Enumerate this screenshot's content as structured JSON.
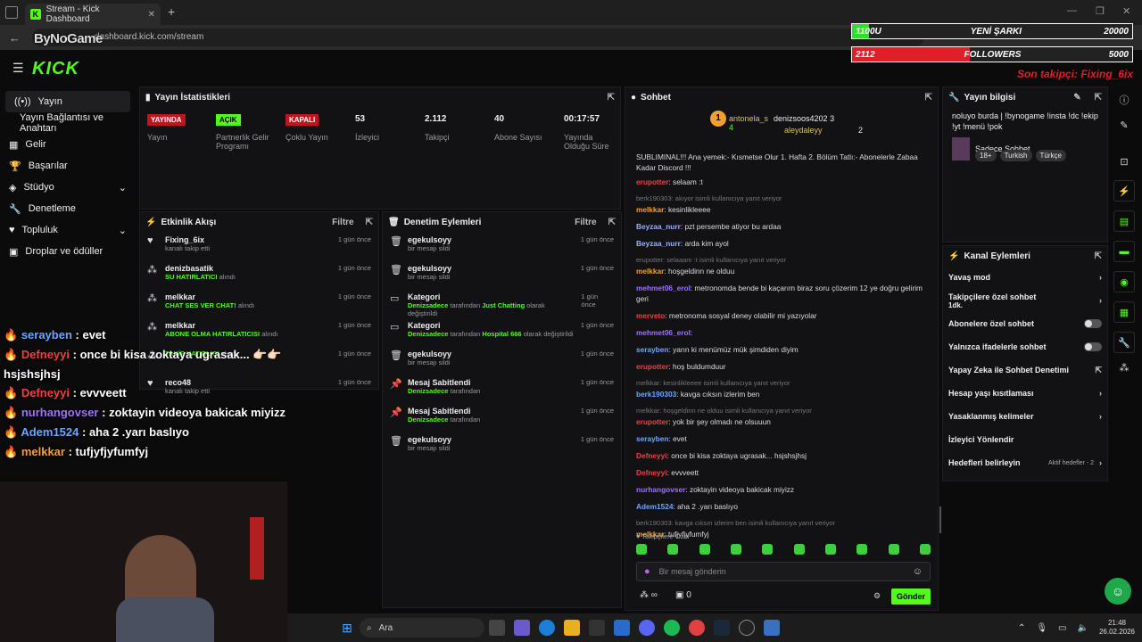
{
  "browser": {
    "tab_title": "Stream - Kick Dashboard",
    "url": "dashboard.kick.com/stream",
    "watermark": "ByNoGame"
  },
  "logo": "KICK",
  "overlay": {
    "songs_left": "1100U",
    "songs_label": "YENİ ŞARKI",
    "songs_right": "20000",
    "followers_left": "2112",
    "followers_label": "FOLLOWERS",
    "followers_right": "5000",
    "last_follower": "Son takipçi: Fixing_6ix",
    "song_fill": 0.06,
    "follower_fill": 0.42
  },
  "sidebar": {
    "items": [
      {
        "label": "Yayın"
      },
      {
        "label": "Yayın Bağlantısı ve Anahtarı"
      },
      {
        "label": "Gelir"
      },
      {
        "label": "Başarılar"
      },
      {
        "label": "Stüdyo"
      },
      {
        "label": "Denetleme"
      },
      {
        "label": "Topluluk"
      },
      {
        "label": "Droplar ve ödüller"
      }
    ]
  },
  "stats": {
    "title": "Yayın İstatistikleri",
    "items": [
      {
        "value": "YAYINDA",
        "label": "Yayın"
      },
      {
        "value": "AÇIK",
        "label": "Partnerlik Gelir Programı"
      },
      {
        "value": "KAPALI",
        "label": "Çoklu Yayın"
      },
      {
        "value": "53",
        "label": "İzleyici"
      },
      {
        "value": "2.112",
        "label": "Takipçi"
      },
      {
        "value": "40",
        "label": "Abone Sayısı"
      },
      {
        "value": "00:17:57",
        "label": "Yayında Olduğu Süre"
      }
    ]
  },
  "activity": {
    "title": "Etkinlik Akışı",
    "filter": "Filtre",
    "items": [
      {
        "name": "Fixing_6ix",
        "sub": "kanalı takip etti",
        "sub_green": "",
        "time": "1 gün önce"
      },
      {
        "name": "denizbasatik",
        "sub": "alındı",
        "sub_green": "SU HATIRLATICI",
        "time": "1 gün önce"
      },
      {
        "name": "melkkar",
        "sub": "alındı",
        "sub_green": "CHAT SES VER CHAT!",
        "time": "1 gün önce"
      },
      {
        "name": "melkkar",
        "sub": "alındı",
        "sub_green": "ABONE OLMA HATIRLATICISI",
        "time": "1 gün önce"
      },
      {
        "name": "",
        "sub": "alındı",
        "sub_green": "TAKİP HATIRLICI",
        "time": "1 gün önce"
      },
      {
        "name": "reco48",
        "sub": "kanalı takip etti",
        "sub_green": "",
        "time": "1 gün önce"
      }
    ]
  },
  "moderation": {
    "title": "Denetim Eylemleri",
    "filter": "Filtre",
    "items": [
      {
        "name": "egekulsoyy",
        "sub": "bir mesajı sildi",
        "time": "1 gün önce",
        "icon": "trash"
      },
      {
        "name": "egekulsoyy",
        "sub": "bir mesajı sildi",
        "time": "1 gün önce",
        "icon": "trash"
      },
      {
        "name": "Kategori",
        "by": "Denizsadece",
        "mid": "tarafından",
        "cat": "Just Chatting",
        "end": "olarak değiştirildi",
        "time": "1 gün önce",
        "icon": "cat"
      },
      {
        "name": "Kategori",
        "by": "Denizsadece",
        "mid": "tarafından",
        "cat": "Hospital 666",
        "end": "olarak değiştirildi",
        "time": "1 gün önce",
        "icon": "cat"
      },
      {
        "name": "egekulsoyy",
        "sub": "bir mesajı sildi",
        "time": "1 gün önce",
        "icon": "trash"
      },
      {
        "name": "Mesaj Sabitlendi",
        "by": "Denizsadece",
        "mid": "tarafından",
        "time": "1 gün önce",
        "icon": "pin"
      },
      {
        "name": "Mesaj Sabitlendi",
        "by": "Denizsadece",
        "mid": "tarafından",
        "time": "1 gün önce",
        "icon": "pin"
      },
      {
        "name": "egekulsoyy",
        "sub": "bir mesajı sildi",
        "time": "1 gün önce",
        "icon": "trash"
      }
    ]
  },
  "chat": {
    "title": "Sohbet",
    "top": [
      {
        "name": "antonela_s",
        "count": "4"
      },
      {
        "name": "denizsoos4202",
        "count": "3"
      },
      {
        "name": "aleydaleyy",
        "count": "2"
      }
    ],
    "pinned": "SUBLIMINAL!!! Ana yemek:- Kısmetse Olur 1. Hafta 2. Bölüm Tatlı:- Abonelerle Zabaa Kadar Discord !!!",
    "messages": [
      {
        "user": "erupotter",
        "color": "#f04040",
        "text": "selaam :t",
        "rep": ""
      },
      {
        "user": "melkkar",
        "color": "#f0a030",
        "text": "kesinlikleeee",
        "rep": "berk190303: akıyor isimli kullanıcıya yanıt veriyor"
      },
      {
        "user": "Beyzaa_nurr",
        "color": "#9ab0ff",
        "text": "pzt persembe atiyor bu ardaa",
        "rep": ""
      },
      {
        "user": "Beyzaa_nurr",
        "color": "#9ab0ff",
        "text": "arda kim ayol",
        "rep": ""
      },
      {
        "user": "melkkar",
        "color": "#f0a030",
        "text": "hoşgeldinn ne olduu",
        "rep": "erupotter: selaaam :t isimli kullanıcıya yanıt veriyor"
      },
      {
        "user": "mehmet06_erol",
        "color": "#a070ff",
        "text": "metronomda bende bi kaçarım biraz soru çözerim 12 ye doğru gelirim geri",
        "rep": ""
      },
      {
        "user": "merveto",
        "color": "#f04040",
        "text": "metronoma sosyal deney olabilir mi yazıyolar",
        "rep": ""
      },
      {
        "user": "mehmet06_erol",
        "color": "#a070ff",
        "text": "",
        "rep": ""
      },
      {
        "user": "serayben",
        "color": "#6aa8ff",
        "text": "yarın ki menümüz mük şimdiden diyim",
        "rep": ""
      },
      {
        "user": "erupotter",
        "color": "#f04040",
        "text": "hoş buldumduur",
        "rep": ""
      },
      {
        "user": "berk190303",
        "color": "#6aa8ff",
        "text": "kavga cıksın izlerim ben",
        "rep": "melkkar: kesinlikleeee isimli kullanıcıya yanıt veriyor"
      },
      {
        "user": "erupotter",
        "color": "#f04040",
        "text": "yok bir şey olmadı ne olsuuun",
        "rep": "melkkar: hoşgeldinn ne olduu isimli kullanıcıya yanıt veriyor"
      },
      {
        "user": "serayben",
        "color": "#6aa8ff",
        "text": "evet",
        "rep": ""
      },
      {
        "user": "Defneyyi",
        "color": "#f04040",
        "text": "once bi kisa zoktaya ugrasak... hsjshsjhsj",
        "rep": ""
      },
      {
        "user": "Defneyyi",
        "color": "#f04040",
        "text": "evvveett",
        "rep": ""
      },
      {
        "user": "nurhangovser",
        "color": "#a070ff",
        "text": "zoktayin videoya bakicak miyizz",
        "rep": ""
      },
      {
        "user": "Adem1524",
        "color": "#6aa8ff",
        "text": "aha 2 .yarı baslıyo",
        "rep": ""
      },
      {
        "user": "melkkar",
        "color": "#f0a030",
        "text": "tufjyfjyfumfyj",
        "rep": "berk190303: kavga cıksın izlerim ben isimli kullanıcıya yanıt veriyor"
      }
    ],
    "followers_only": "Takipçilere Özel",
    "input_placeholder": "Bir mesaj gönderin",
    "send": "Gönder",
    "count": "0"
  },
  "stream_info": {
    "title": "Yayın bilgisi",
    "text": "noluyo burda | !bynogame !insta !dc !ekip !yt !menü !pok",
    "category": "Sadece Sohbet",
    "tags": [
      "18+",
      "Turkish",
      "Türkçe"
    ]
  },
  "channel_actions": {
    "title": "Kanal Eylemleri",
    "items": [
      {
        "label": "Yavaş mod",
        "type": "chev"
      },
      {
        "label": "Takipçilere özel sohbet",
        "sub": "1dk.",
        "type": "chev"
      },
      {
        "label": "Abonelere özel sohbet",
        "type": "tog"
      },
      {
        "label": "Yalnızca ifadelerle sohbet",
        "type": "tog"
      },
      {
        "label": "Yapay Zeka ile Sohbet Denetimi",
        "type": "ext"
      },
      {
        "label": "Hesap yaşı kısıtlaması",
        "type": "chev"
      },
      {
        "label": "Yasaklanmış kelimeler",
        "type": "chev"
      },
      {
        "label": "İzleyici Yönlendir",
        "type": ""
      },
      {
        "label": "Hedefleri belirleyin",
        "extra": "Aktif hedefler - 2",
        "type": "chev"
      }
    ]
  },
  "overlay_chat": [
    {
      "user": "serayben",
      "color": "#6aa8ff",
      "text": ": evet"
    },
    {
      "user": "Defneyyi",
      "color": "#f04040",
      "text": ": once bi kisa zoktaya ugrasak... 👉🏻👉🏻"
    },
    {
      "user": "",
      "color": "#fff",
      "text": "hsjshsjhsj"
    },
    {
      "user": "Defneyyi",
      "color": "#f04040",
      "text": ": evvveett"
    },
    {
      "user": "nurhangovser",
      "color": "#a070ff",
      "text": ": zoktayin videoya bakicak miyizz"
    },
    {
      "user": "Adem1524",
      "color": "#6aa8ff",
      "text": ": aha 2 .yarı baslıyo"
    },
    {
      "user": "melkkar",
      "color": "#f0a030",
      "text": ": tufjyfjyfumfyj"
    }
  ],
  "taskbar": {
    "search": "Ara",
    "time": "21:48",
    "date": "26.02.2026"
  }
}
